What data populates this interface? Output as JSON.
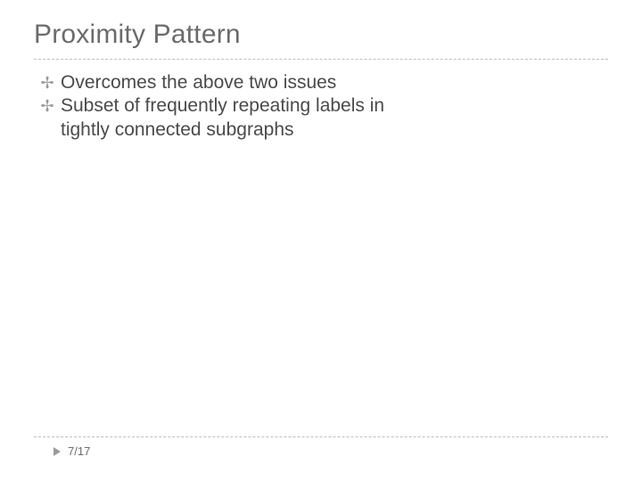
{
  "title": "Proximity Pattern",
  "bullets": [
    {
      "glyph": "✢",
      "text": "Overcomes the above two issues"
    },
    {
      "glyph": "✢",
      "text": "Subset of frequently repeating labels in tightly connected subgraphs"
    }
  ],
  "page": "7/17"
}
